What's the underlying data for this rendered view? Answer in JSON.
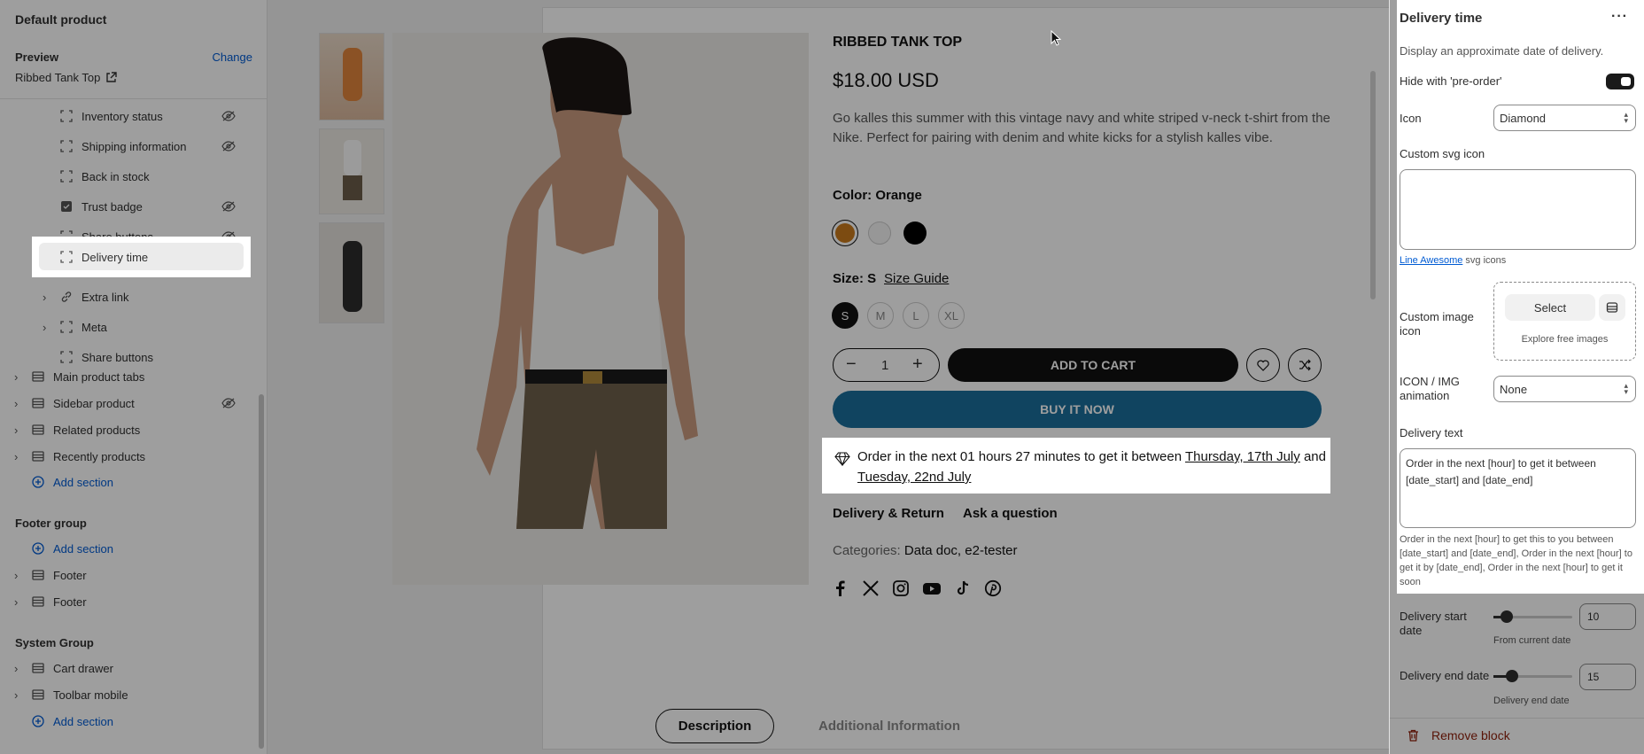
{
  "left": {
    "title": "Default product",
    "preview_label": "Preview",
    "change_label": "Change",
    "preview_product": "Ribbed Tank Top",
    "tree": [
      {
        "label": "Inventory status",
        "hidden": true
      },
      {
        "label": "Shipping information",
        "hidden": true
      },
      {
        "label": "Back in stock",
        "hidden": false
      },
      {
        "label": "Trust badge",
        "hidden": true
      },
      {
        "label": "Share buttons",
        "hidden": true
      },
      {
        "label": "Delivery time",
        "hidden": false,
        "selected": true
      },
      {
        "label": "Extra link",
        "hidden": false
      },
      {
        "label": "Meta",
        "hidden": false
      },
      {
        "label": "Share buttons",
        "hidden": false
      }
    ],
    "sections": [
      {
        "label": "Main product tabs",
        "hidden": false
      },
      {
        "label": "Sidebar product",
        "hidden": true
      },
      {
        "label": "Related products",
        "hidden": false
      },
      {
        "label": "Recently products",
        "hidden": false
      }
    ],
    "add_section": "Add section",
    "footer_group": "Footer group",
    "footer_items": [
      "Footer",
      "Footer"
    ],
    "system_group": "System Group",
    "system_items": [
      "Cart drawer",
      "Toolbar mobile"
    ]
  },
  "product": {
    "title": "RIBBED TANK TOP",
    "price": "$18.00 USD",
    "description": "Go kalles this summer with this vintage navy and white striped v-neck t-shirt from the Nike. Perfect for pairing with denim and white kicks for a stylish kalles vibe.",
    "color_label": "Color: Orange",
    "swatches": [
      "#c97a1c",
      "#f4f4f4",
      "#000000"
    ],
    "size_label": "Size: S",
    "size_guide": "Size Guide",
    "sizes": [
      "S",
      "M",
      "L",
      "XL"
    ],
    "qty": "1",
    "add_to_cart": "ADD TO CART",
    "buy_now": "BUY IT NOW",
    "delivery_prefix": "Order in the next 01 hours 27 minutes to get it between",
    "delivery_start": "Thursday, 17th July",
    "delivery_and": "and",
    "delivery_end": "Tuesday, 22nd July",
    "delivery_return": "Delivery & Return",
    "ask_question": "Ask a question",
    "categories_label": "Categories:",
    "categories_value": "Data doc, e2-tester",
    "tab_description": "Description",
    "tab_additional": "Additional Information",
    "social": [
      "facebook-icon",
      "x-icon",
      "instagram-icon",
      "youtube-icon",
      "tiktok-icon",
      "pinterest-icon"
    ]
  },
  "right": {
    "title": "Delivery time",
    "info": "Display an approximate date of delivery.",
    "hide_preorder": "Hide with 'pre-order'",
    "icon_label": "Icon",
    "icon_value": "Diamond",
    "custom_svg_label": "Custom svg icon",
    "line_awesome": "Line Awesome",
    "svg_icons": "svg icons",
    "custom_image_label": "Custom image icon",
    "select_label": "Select",
    "explore_label": "Explore free images",
    "animation_label": "ICON / IMG animation",
    "animation_value": "None",
    "delivery_text_label": "Delivery text",
    "delivery_text_value": "Order in the next [hour] to get it between [date_start] and [date_end]",
    "delivery_help": "Order in the next [hour] to get this to you between [date_start] and [date_end], Order in the next [hour] to get it by [date_end], Order in the next [hour] to get it soon",
    "start_label": "Delivery start date",
    "start_value": "10",
    "start_help": "From current date",
    "end_label": "Delivery end date",
    "end_value": "15",
    "end_help": "Delivery end date",
    "remove": "Remove block",
    "accent": "#005bd3",
    "danger": "#8e1f0b"
  }
}
